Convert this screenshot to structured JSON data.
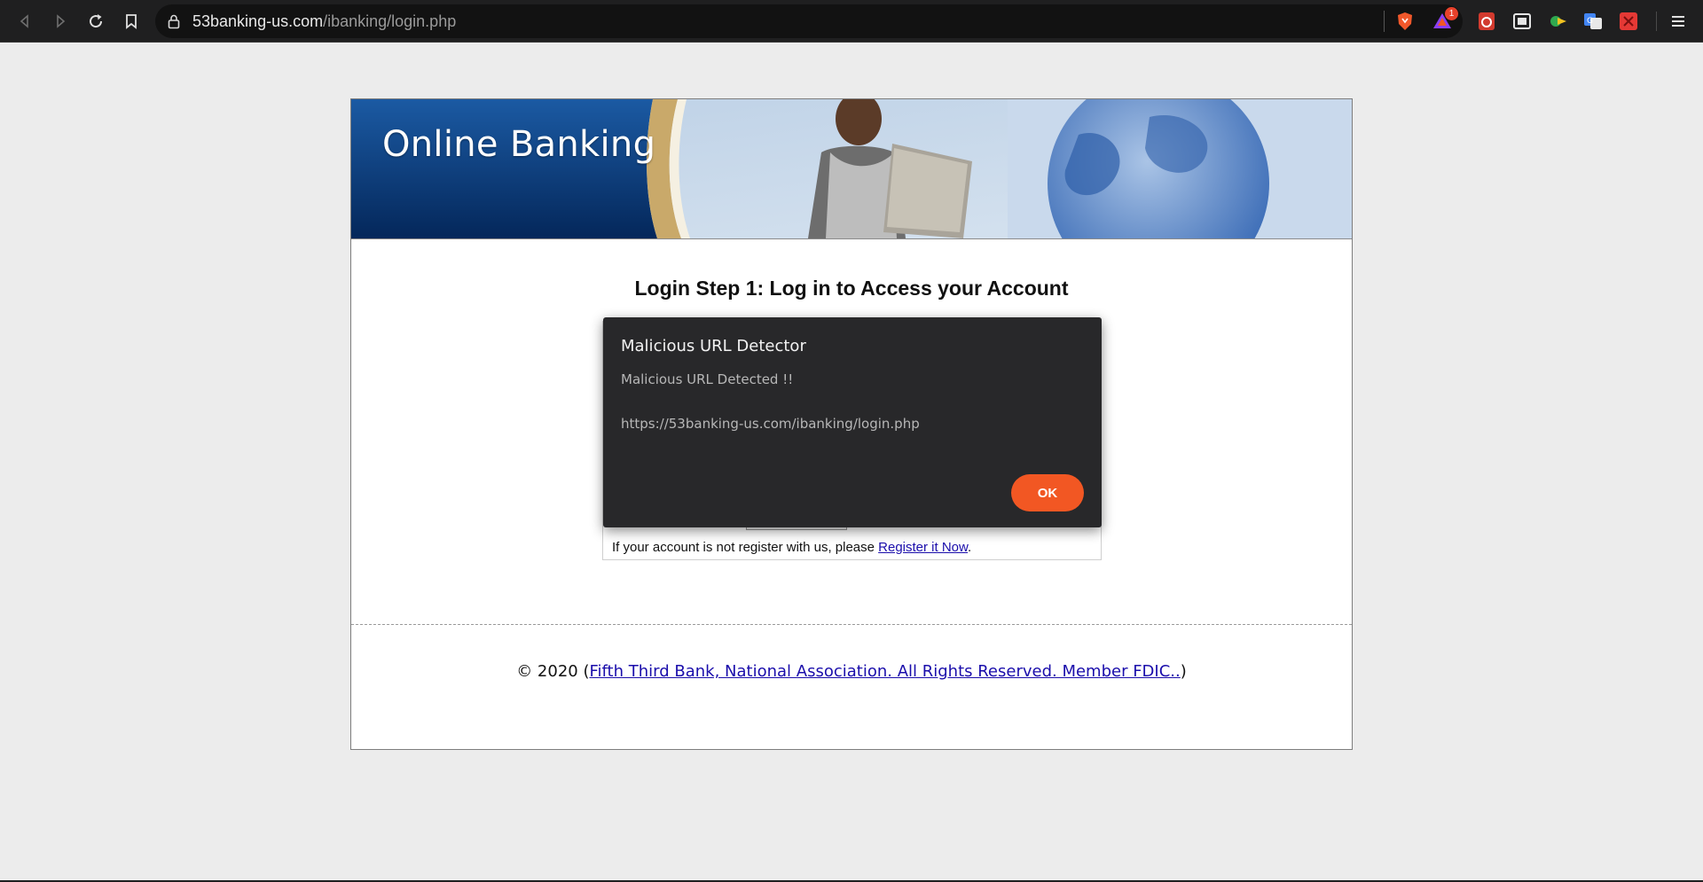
{
  "browser": {
    "url_host": "53banking-us.com",
    "url_path": "/ibanking/login.php",
    "brave_badge_count": "1",
    "icons": [
      "back-icon",
      "forward-icon",
      "reload-icon",
      "bookmark-icon",
      "lock-icon",
      "brave-shield-icon",
      "brave-rewards-icon",
      "extension-icon",
      "extension-icon",
      "extension-icon",
      "translate-icon",
      "extension-icon",
      "menu-icon"
    ]
  },
  "page": {
    "banner_title": "Online Banking",
    "heading": "Login Step 1: Log in to Access your Account",
    "register_text": "If your account is not register with us, please ",
    "register_link": "Register it Now",
    "register_suffix": ".",
    "footer_prefix": "© 2020 (",
    "footer_link": "Fifth Third Bank, National Association. All Rights Reserved. Member FDIC..",
    "footer_suffix": ")"
  },
  "modal": {
    "title": "Malicious URL Detector",
    "message": "Malicious URL Detected !!",
    "url": "https://53banking-us.com/ibanking/login.php",
    "ok_label": "OK"
  },
  "colors": {
    "toolbar_bg": "#1f1f20",
    "page_bg": "#ececec",
    "modal_bg": "#28282a",
    "ok_button": "#f25723",
    "link": "#1a0dab",
    "banner_blue": "#0b3a78"
  }
}
